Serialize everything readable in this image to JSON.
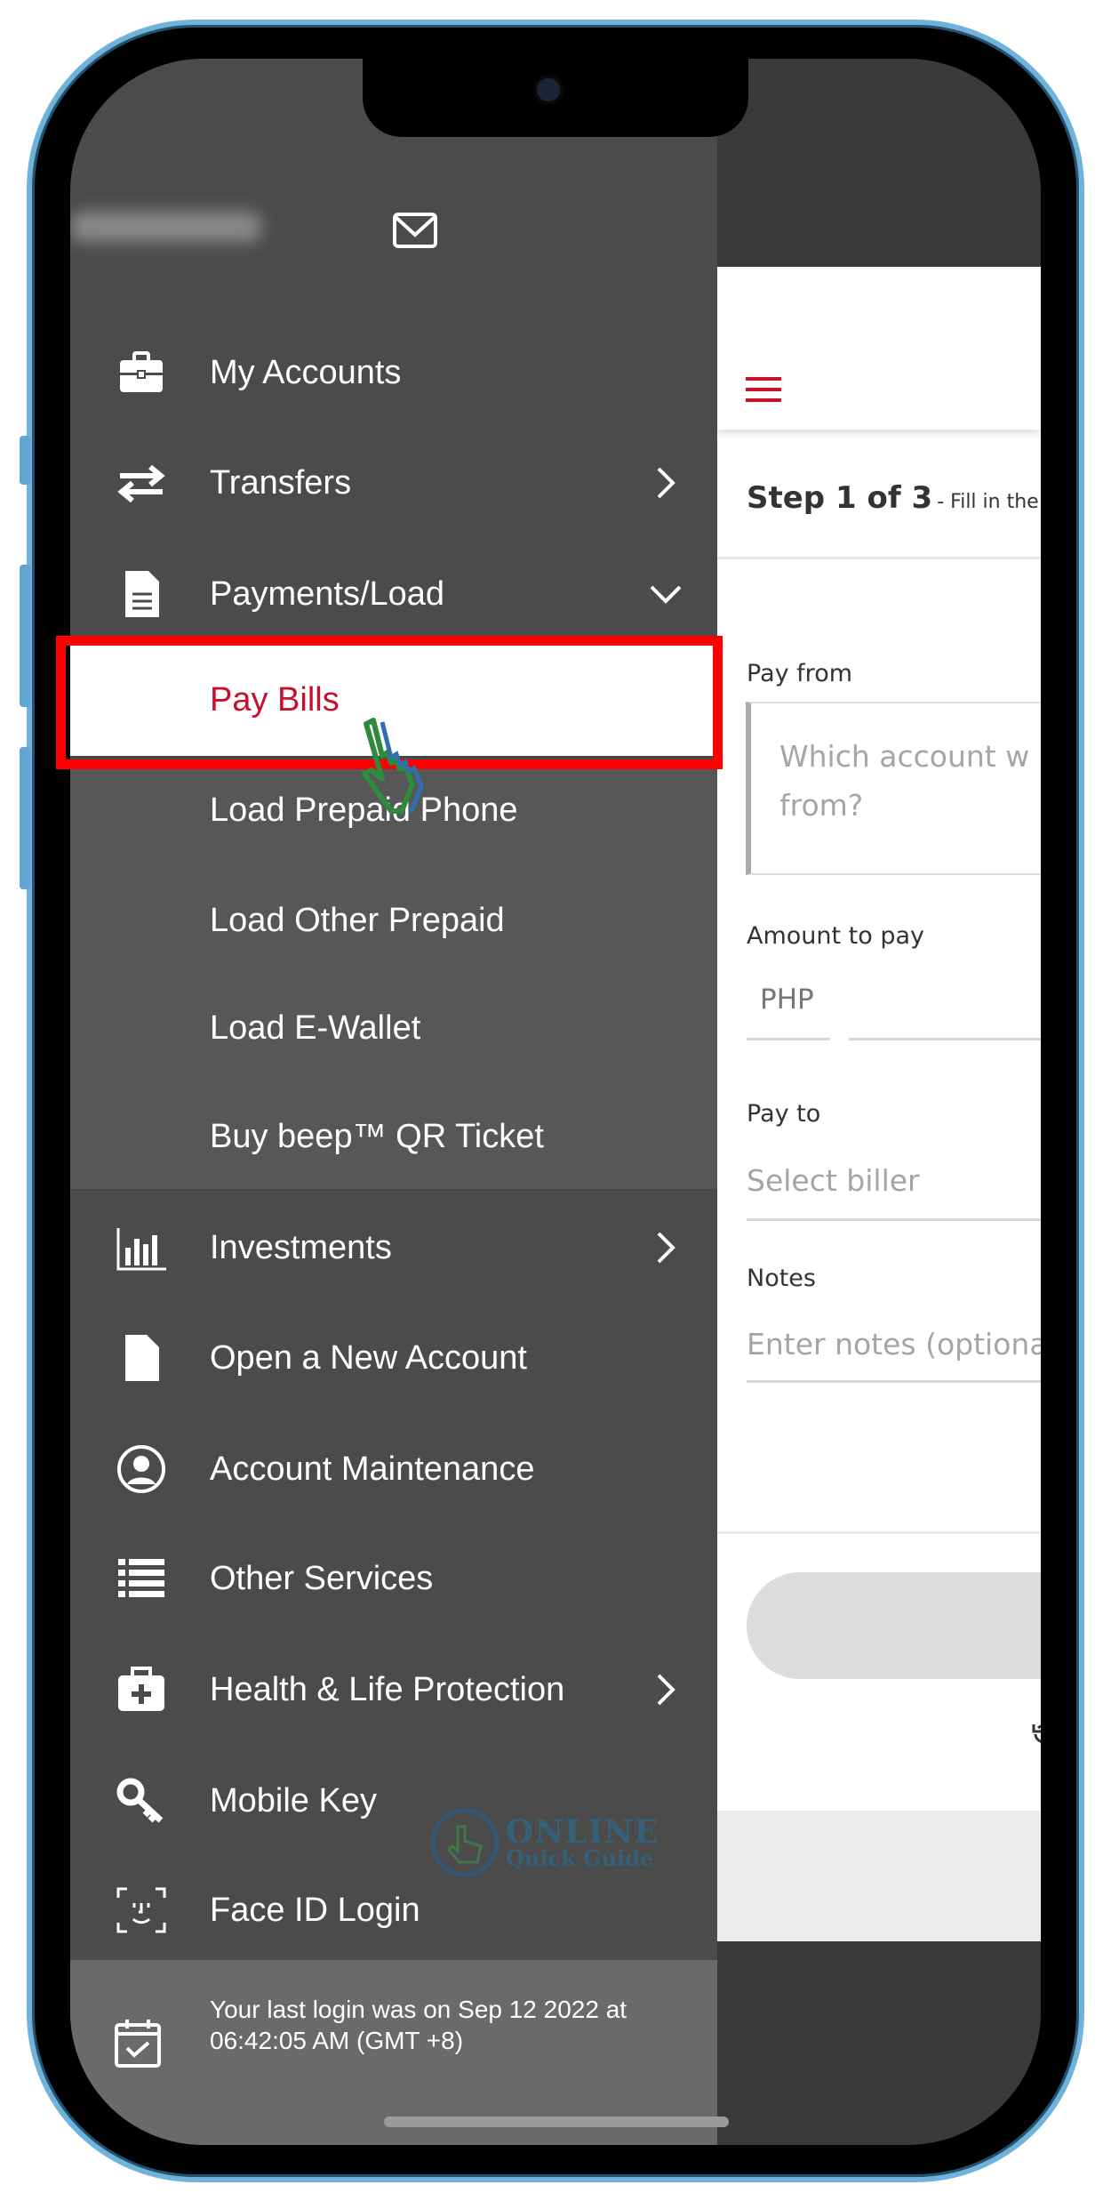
{
  "sidebar": {
    "user_name": "",
    "items": [
      {
        "label": "My Accounts",
        "icon": "briefcase-icon"
      },
      {
        "label": "Transfers",
        "icon": "transfer-arrows-icon",
        "chevron": "right"
      },
      {
        "label": "Payments/Load",
        "icon": "document-icon",
        "chevron": "down"
      },
      {
        "label": "Investments",
        "icon": "bar-chart-icon",
        "chevron": "right"
      },
      {
        "label": "Open a New Account",
        "icon": "file-icon"
      },
      {
        "label": "Account Maintenance",
        "icon": "user-circle-icon"
      },
      {
        "label": "Other Services",
        "icon": "list-icon"
      },
      {
        "label": "Health & Life Protection",
        "icon": "medical-kit-icon",
        "chevron": "right"
      },
      {
        "label": "Mobile Key",
        "icon": "key-icon"
      },
      {
        "label": "Face ID Login",
        "icon": "face-id-icon"
      }
    ],
    "submenu": [
      "Pay Bills",
      "Load Prepaid Phone",
      "Load Other Prepaid",
      "Load E-Wallet",
      "Buy beep™ QR Ticket"
    ],
    "selected": "Pay Bills",
    "last_login_line1": "Your last login was on Sep 12 2022 at",
    "last_login_line2": "06:42:05 AM (GMT +8)"
  },
  "form": {
    "step": "Step 1 of 3",
    "step_hint": "- Fill in the",
    "pay_from_label": "Pay from",
    "pay_from_placeholder_1": "Which account w",
    "pay_from_placeholder_2": "from?",
    "amount_label": "Amount to pay",
    "currency": "PHP",
    "pay_to_label": "Pay to",
    "pay_to_placeholder": "Select biller",
    "notes_label": "Notes",
    "notes_placeholder": "Enter notes (optional)"
  },
  "watermark": {
    "line1": "ONLINE",
    "line2": "Quick Guide"
  },
  "colors": {
    "accent": "#c8102e",
    "highlight": "#ff0000",
    "menu_bg": "#4b4b4b"
  }
}
